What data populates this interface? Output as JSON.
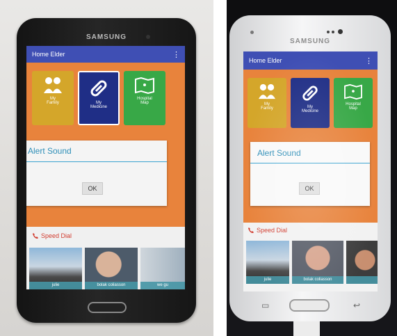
{
  "phones": [
    {
      "brand": "SAMSUNG",
      "app_title": "Home Elder",
      "menu_icon": "overflow-menu-icon",
      "tiles": [
        {
          "label": "My\nFamily",
          "icon": "family-icon",
          "color": "#d4a62a"
        },
        {
          "label": "My\nMedicine",
          "icon": "pill-icon",
          "color": "#1f2e86"
        },
        {
          "label": "Hospital\nMap",
          "icon": "map-icon",
          "color": "#38a847"
        }
      ],
      "dialog": {
        "title": "Alert Sound",
        "ok_label": "OK"
      },
      "speed_dial_label": "Speed Dial",
      "contacts": [
        "julie",
        "bolak coliasson",
        "we gu"
      ]
    },
    {
      "brand": "SAMSUNG",
      "app_title": "Home Elder",
      "menu_icon": "overflow-menu-icon",
      "tiles": [
        {
          "label": "My\nFamily",
          "icon": "family-icon",
          "color": "#d4a62a"
        },
        {
          "label": "My\nMedicine",
          "icon": "pill-icon",
          "color": "#1f2e86"
        },
        {
          "label": "Hospital\nMap",
          "icon": "map-icon",
          "color": "#38a847"
        }
      ],
      "dialog": {
        "title": "Alert Sound",
        "ok_label": "OK"
      },
      "speed_dial_label": "Speed Dial",
      "contacts": [
        "julie",
        "bolak coliasson",
        ""
      ]
    }
  ],
  "colors": {
    "app_bar": "#3f4fb4",
    "tile_background": "#e8833c",
    "dialog_accent": "#3aa3d0",
    "speed_dial_text": "#d13b2e"
  }
}
